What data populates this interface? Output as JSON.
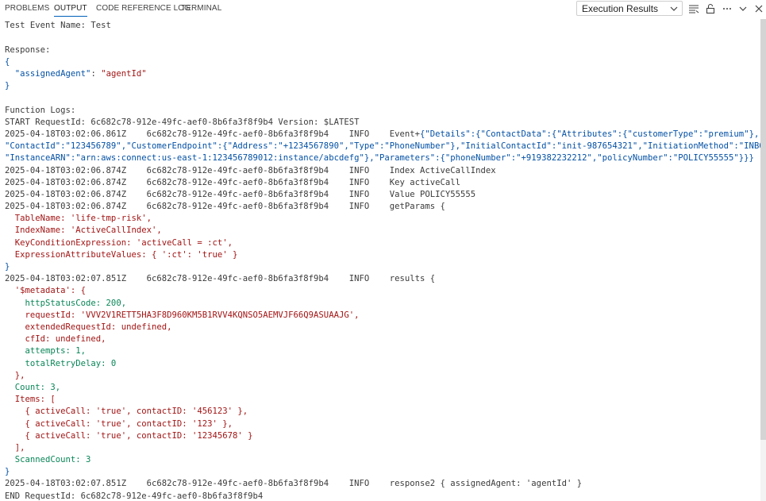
{
  "tabs": [
    {
      "label": "PROBLEMS"
    },
    {
      "label": "OUTPUT"
    },
    {
      "label": "CODE REFERENCE LOG"
    },
    {
      "label": "TERMINAL"
    }
  ],
  "channel_select": {
    "value": "Execution Results"
  },
  "icons": [
    "list-filter-icon",
    "lock-icon",
    "ellipsis-icon",
    "chevron-down-icon",
    "close-icon"
  ],
  "log": {
    "l01": "Test Event Name: Test",
    "l02": "Response:",
    "l03": "{",
    "l04a": "  \"assignedAgent\"",
    "l04b": ": ",
    "l04c": "\"agentId\"",
    "l05": "}",
    "l06": "Function Logs:",
    "l07": "START RequestId: 6c682c78-912e-49fc-aef0-8b6fa3f8f9b4 Version: $LATEST",
    "l08a": "2025-04-18T03:02:06.861Z    6c682c78-912e-49fc-aef0-8b6fa3f8f9b4    INFO    Event+",
    "l08b": "{\"Details\":{\"ContactData\":{\"Attributes\":{\"customerType\":\"premium\"},",
    "l09": "\"ContactId\":\"123456789\",\"CustomerEndpoint\":{\"Address\":\"+1234567890\",\"Type\":\"PhoneNumber\"},\"InitialContactId\":\"init-987654321\",\"InitiationMethod\":\"INBOUND\",",
    "l10": "\"InstanceARN\":\"arn:aws:connect:us-east-1:123456789012:instance/abcdefg\"},\"Parameters\":{\"phoneNumber\":\"+919382232212\",\"policyNumber\":\"POLICY55555\"}}}",
    "l11": "2025-04-18T03:02:06.874Z    6c682c78-912e-49fc-aef0-8b6fa3f8f9b4    INFO    Index ActiveCallIndex",
    "l12": "2025-04-18T03:02:06.874Z    6c682c78-912e-49fc-aef0-8b6fa3f8f9b4    INFO    Key activeCall",
    "l13": "2025-04-18T03:02:06.874Z    6c682c78-912e-49fc-aef0-8b6fa3f8f9b4    INFO    Value POLICY55555",
    "l14": "2025-04-18T03:02:06.874Z    6c682c78-912e-49fc-aef0-8b6fa3f8f9b4    INFO    getParams {",
    "l15": "  TableName: 'life-tmp-risk',",
    "l16": "  IndexName: 'ActiveCallIndex',",
    "l17": "  KeyConditionExpression: 'activeCall = :ct',",
    "l18": "  ExpressionAttributeValues: { ':ct': 'true' }",
    "l19": "}",
    "l20": "2025-04-18T03:02:07.851Z    6c682c78-912e-49fc-aef0-8b6fa3f8f9b4    INFO    results {",
    "l21": "  '$metadata': {",
    "l22": "    httpStatusCode: 200,",
    "l23": "    requestId: 'VVV2V1RETT5HA3F8D960KM5B1RVV4KQNSO5AEMVJF66Q9ASUAAJG',",
    "l24": "    extendedRequestId: undefined,",
    "l25": "    cfId: undefined,",
    "l26": "    attempts: 1,",
    "l27": "    totalRetryDelay: 0",
    "l28": "  },",
    "l29": "  Count: 3,",
    "l30": "  Items: [",
    "l31": "    { activeCall: 'true', contactID: '456123' },",
    "l32": "    { activeCall: 'true', contactID: '123' },",
    "l33": "    { activeCall: 'true', contactID: '12345678' }",
    "l34": "  ],",
    "l35": "  ScannedCount: 3",
    "l36": "}",
    "l37": "2025-04-18T03:02:07.851Z    6c682c78-912e-49fc-aef0-8b6fa3f8f9b4    INFO    response2 { assignedAgent: 'agentId' }",
    "l38": "END RequestId: 6c682c78-912e-49fc-aef0-8b6fa3f8f9b4"
  },
  "colors": {
    "accent": "#005fb8",
    "string": "#a31515",
    "key": "#0451a5",
    "number": "#098658"
  }
}
